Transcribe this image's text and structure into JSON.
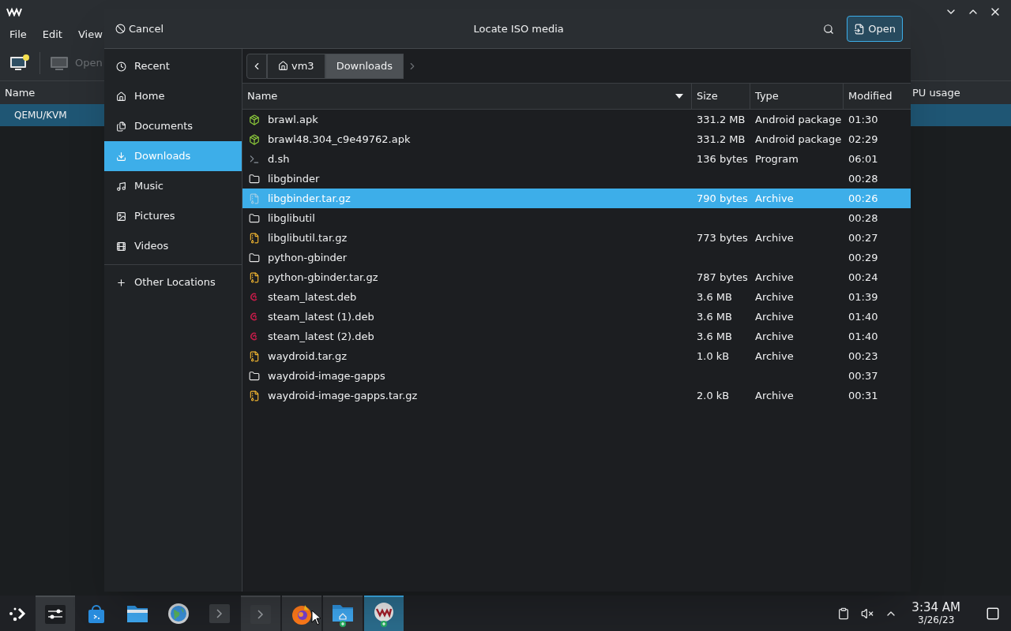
{
  "background_window": {
    "menu": [
      "File",
      "Edit",
      "View"
    ],
    "toolbar": [
      {
        "kind": "new",
        "disabled": false
      },
      {
        "kind": "open",
        "label": "Open",
        "disabled": true
      }
    ],
    "columns": [
      "Name",
      "PU usage"
    ],
    "rows": [
      {
        "name": "QEMU/KVM",
        "selected": true
      }
    ]
  },
  "dialog": {
    "cancel": "Cancel",
    "title": "Locate ISO media",
    "open": "Open",
    "places": [
      {
        "kind": "recent",
        "label": "Recent",
        "selected": false
      },
      {
        "kind": "home",
        "label": "Home",
        "selected": false
      },
      {
        "kind": "documents",
        "label": "Documents",
        "selected": false
      },
      {
        "kind": "downloads",
        "label": "Downloads",
        "selected": true
      },
      {
        "kind": "music",
        "label": "Music",
        "selected": false
      },
      {
        "kind": "pictures",
        "label": "Pictures",
        "selected": false
      },
      {
        "kind": "videos",
        "label": "Videos",
        "selected": false
      }
    ],
    "other_locations": "Other Locations",
    "path": [
      {
        "kind": "home",
        "label": "vm3",
        "selected": false
      },
      {
        "kind": "folder",
        "label": "Downloads",
        "selected": true
      }
    ],
    "columns": [
      "Name",
      "Size",
      "Type",
      "Modified"
    ],
    "files": [
      {
        "kind": "apk",
        "name": "brawl.apk",
        "size": "331.2 MB",
        "type": "Android package",
        "modified": "01:30",
        "selected": false
      },
      {
        "kind": "apk",
        "name": "brawl48.304_c9e49762.apk",
        "size": "331.2 MB",
        "type": "Android package",
        "modified": "02:29",
        "selected": false
      },
      {
        "kind": "script",
        "name": "d.sh",
        "size": "136 bytes",
        "type": "Program",
        "modified": "06:01",
        "selected": false
      },
      {
        "kind": "folder",
        "name": "libgbinder",
        "modified": "00:28",
        "selected": false
      },
      {
        "kind": "archive",
        "name": "libgbinder.tar.gz",
        "size": "790 bytes",
        "type": "Archive",
        "modified": "00:26",
        "selected": true
      },
      {
        "kind": "folder",
        "name": "libglibutil",
        "modified": "00:28",
        "selected": false
      },
      {
        "kind": "archive",
        "name": "libglibutil.tar.gz",
        "size": "773 bytes",
        "type": "Archive",
        "modified": "00:27",
        "selected": false
      },
      {
        "kind": "folder",
        "name": "python-gbinder",
        "modified": "00:29",
        "selected": false
      },
      {
        "kind": "archive",
        "name": "python-gbinder.tar.gz",
        "size": "787 bytes",
        "type": "Archive",
        "modified": "00:24",
        "selected": false
      },
      {
        "kind": "deb",
        "name": "steam_latest.deb",
        "size": "3.6 MB",
        "type": "Archive",
        "modified": "01:39",
        "selected": false
      },
      {
        "kind": "deb",
        "name": "steam_latest (1).deb",
        "size": "3.6 MB",
        "type": "Archive",
        "modified": "01:40",
        "selected": false
      },
      {
        "kind": "deb",
        "name": "steam_latest (2).deb",
        "size": "3.6 MB",
        "type": "Archive",
        "modified": "01:40",
        "selected": false
      },
      {
        "kind": "archive",
        "name": "waydroid.tar.gz",
        "size": "1.0 kB",
        "type": "Archive",
        "modified": "00:23",
        "selected": false
      },
      {
        "kind": "folder",
        "name": "waydroid-image-gapps",
        "modified": "00:37",
        "selected": false
      },
      {
        "kind": "archive",
        "name": "waydroid-image-gapps.tar.gz",
        "size": "2.0 kB",
        "type": "Archive",
        "modified": "00:31",
        "selected": false
      }
    ]
  },
  "taskbar": {
    "apps": [
      {
        "kind": "sliders",
        "running": true,
        "selected": false
      },
      {
        "kind": "store",
        "running": false,
        "selected": false
      },
      {
        "kind": "files",
        "running": false,
        "selected": false
      },
      {
        "kind": "globe",
        "running": false,
        "selected": false
      },
      {
        "kind": "terminal",
        "running": false,
        "selected": false
      },
      {
        "kind": "terminal",
        "running": true,
        "selected": false
      },
      {
        "kind": "firefox",
        "running": true,
        "selected": false
      },
      {
        "kind": "homefolder",
        "running": true,
        "selected": false
      },
      {
        "kind": "vm",
        "running": true,
        "selected": true
      }
    ],
    "time": "3:34 AM",
    "date": "3/26/23"
  }
}
